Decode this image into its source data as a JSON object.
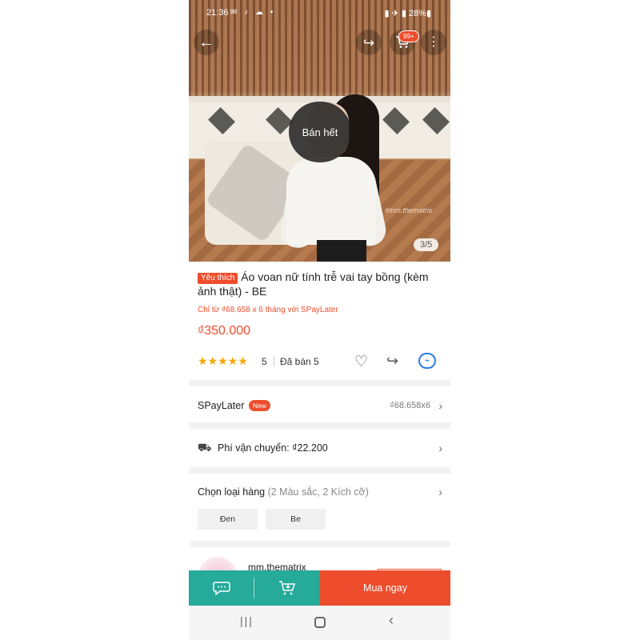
{
  "status_bar": {
    "time": "21:36",
    "notification_icons": "✉ ♪ ☁ •",
    "right": "▮ ✈ ▮ 28%▮"
  },
  "hero": {
    "sold_out_label": "Bán hết",
    "watermark": "#mm.thematrix",
    "pager": "3/5",
    "cart_badge": "99+"
  },
  "product": {
    "favorite_tag": "Yêu thích",
    "title": "Áo voan nữ tính trễ vai tay bồng (kèm ảnh thật) - BE",
    "spaylater_subtitle": "Chỉ từ ₫68.658 x 6 tháng với SPayLater",
    "price": "₫350.000",
    "stars": "★★★★★",
    "rating": "5",
    "sold": "Đã bán 5",
    "rating_value": 5
  },
  "spaylater": {
    "label": "SPayLater",
    "badge": "New",
    "value": "₫68.658x6"
  },
  "shipping": {
    "label": "Phí vận chuyển: ₫22.200"
  },
  "variants": {
    "label": "Chọn loại hàng",
    "sub": "(2 Màu sắc, 2 Kích cỡ)",
    "options": [
      "Đen",
      "Be"
    ]
  },
  "shop": {
    "name": "mm.thematrix"
  },
  "bottom_bar": {
    "buy_now": "Mua ngay"
  },
  "colors": {
    "accent": "#ee4d2d",
    "teal": "#26aa99",
    "star": "#f6a700"
  }
}
